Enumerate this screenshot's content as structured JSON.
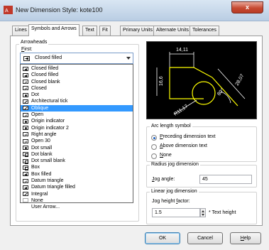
{
  "window": {
    "title": "New Dimension Style: kote100",
    "close_label": "x"
  },
  "tabs": [
    {
      "label": "Lines"
    },
    {
      "label": "Symbols and Arrows"
    },
    {
      "label": "Text"
    },
    {
      "label": "Fit"
    },
    {
      "label": "Primary Units"
    },
    {
      "label": "Alternate Units"
    },
    {
      "label": "Tolerances"
    }
  ],
  "arrowheads": {
    "group_label": "Arrowheads",
    "first_label": "First:",
    "first_value": "Closed filled",
    "options": [
      {
        "label": "Closed filled",
        "icon": "fill"
      },
      {
        "label": "Closed filled",
        "icon": "fill"
      },
      {
        "label": "Closed blank",
        "icon": "blank"
      },
      {
        "label": "Closed",
        "icon": "blank"
      },
      {
        "label": "Dot",
        "icon": "dot"
      },
      {
        "label": "Architectural tick",
        "icon": "tick"
      },
      {
        "label": "Oblique",
        "icon": "tick"
      },
      {
        "label": "Open",
        "icon": "blank"
      },
      {
        "label": "Origin indicator",
        "icon": "dot"
      },
      {
        "label": "Origin indicator 2",
        "icon": "dot"
      },
      {
        "label": "Right angle",
        "icon": "blank"
      },
      {
        "label": "Open 30",
        "icon": "blank"
      },
      {
        "label": "Dot small",
        "icon": "dot"
      },
      {
        "label": "Dot blank",
        "icon": "box"
      },
      {
        "label": "Dot small blank",
        "icon": "box"
      },
      {
        "label": "Box",
        "icon": "box"
      },
      {
        "label": "Box filled",
        "icon": "fill"
      },
      {
        "label": "Datum triangle",
        "icon": "blank"
      },
      {
        "label": "Datum triangle filled",
        "icon": "fill"
      },
      {
        "label": "Integral",
        "icon": "tick"
      },
      {
        "label": "None",
        "icon": "none"
      },
      {
        "label": "User Arrow...",
        "icon": ""
      }
    ],
    "selected_index": 6
  },
  "preview": {
    "dim_top": "14,11",
    "dim_left": "16,6",
    "dim_right": "28,07",
    "dim_radius": "R11,17",
    "dim_angle": "80°"
  },
  "arc_length": {
    "group_label": "Arc length symbol",
    "options": [
      {
        "label": "Preceding dimension text",
        "checked": true
      },
      {
        "label": "Above dimension text",
        "checked": false
      },
      {
        "label": "None",
        "checked": false
      }
    ]
  },
  "radius_jog": {
    "group_label": "Radius jog dimension",
    "angle_label": "Jog angle:",
    "angle_value": "45"
  },
  "linear_jog": {
    "group_label": "Linear jog dimension",
    "height_label": "Jog height factor:",
    "height_value": "1.5",
    "suffix": "* Text height"
  },
  "buttons": {
    "ok": "OK",
    "cancel": "Cancel",
    "help": "Help"
  },
  "colors": {
    "selection": "#3399ff",
    "preview_bg": "#000000",
    "preview_geometry": "#ffff00",
    "preview_dims": "#ffffff"
  }
}
